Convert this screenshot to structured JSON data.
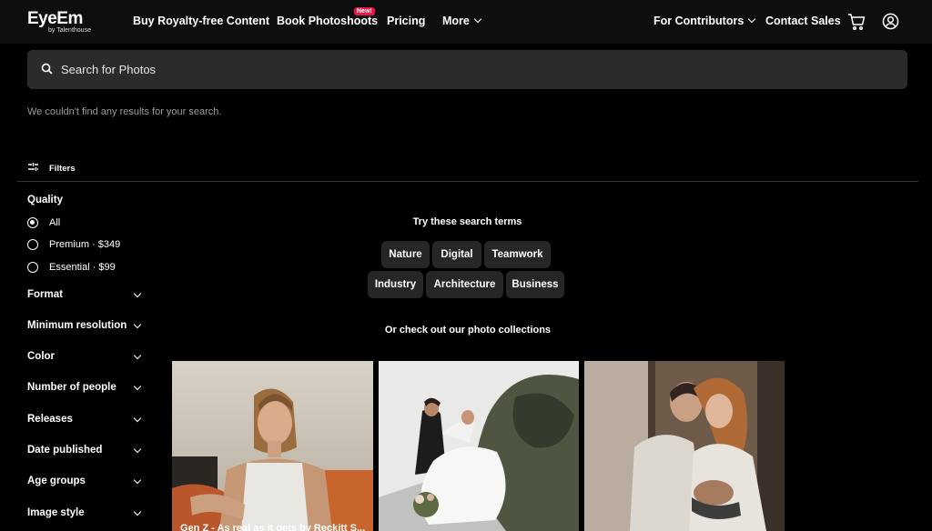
{
  "brand": {
    "name": "EyeEm",
    "sub": "by Talenthouse"
  },
  "nav": {
    "buy": "Buy Royalty-free Content",
    "book": "Book Photoshoots",
    "new_badge": "New!",
    "pricing": "Pricing",
    "more": "More",
    "contributors": "For Contributors",
    "contact": "Contact Sales"
  },
  "search": {
    "placeholder": "Search for Photos",
    "value": ""
  },
  "no_results": "We couldn't find any results for your search.",
  "filters": {
    "label": "Filters",
    "quality": {
      "title": "Quality",
      "options": [
        "All",
        "Premium · $349",
        "Essential · $99"
      ],
      "selected": "All"
    },
    "facets": [
      "Format",
      "Minimum resolution",
      "Color",
      "Number of people",
      "Releases",
      "Date published",
      "Age groups",
      "Image style"
    ]
  },
  "suggestions": {
    "title": "Try these search terms",
    "terms": [
      "Nature",
      "Digital",
      "Teamwork",
      "Industry",
      "Architecture",
      "Business"
    ]
  },
  "collections": {
    "title": "Or check out our photo collections",
    "items": [
      {
        "caption": "Gen Z - As real as it gets by Reckitt S..."
      },
      {
        "caption": ""
      },
      {
        "caption": ""
      }
    ]
  }
}
